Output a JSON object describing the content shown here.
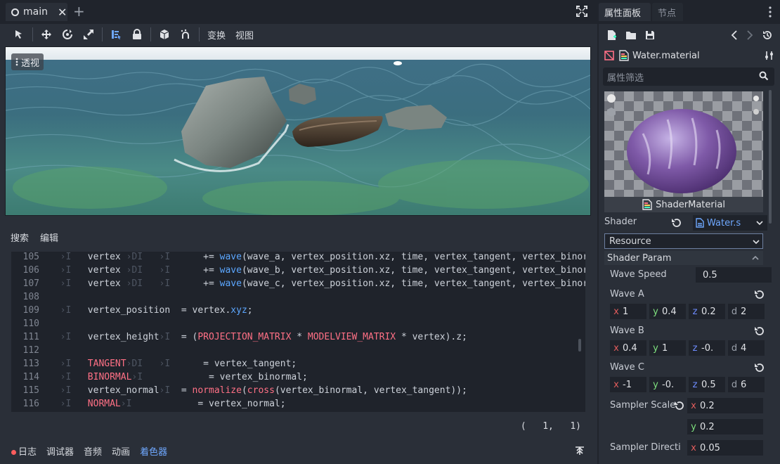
{
  "scene_tabs": {
    "active": "main"
  },
  "toolbar": {
    "transform": "变换",
    "view": "视图"
  },
  "viewport": {
    "label": "透视"
  },
  "script_editor": {
    "menu": [
      "搜索",
      "编辑"
    ],
    "lines": [
      {
        "num": "105",
        "t": [
          [
            "tab",
            "  ›I   "
          ],
          [
            "n",
            "vertex "
          ],
          [
            "tab",
            "›DI   ›I      "
          ],
          [
            "n",
            "+= "
          ],
          [
            "fn",
            "wave"
          ],
          [
            "n",
            "(wave_a, vertex_position.xz, time, vertex_tangent, vertex_binormal"
          ]
        ]
      },
      {
        "num": "106",
        "t": [
          [
            "tab",
            "  ›I   "
          ],
          [
            "n",
            "vertex "
          ],
          [
            "tab",
            "›DI   ›I      "
          ],
          [
            "n",
            "+= "
          ],
          [
            "fn",
            "wave"
          ],
          [
            "n",
            "(wave_b, vertex_position.xz, time, vertex_tangent, vertex_binormal"
          ]
        ]
      },
      {
        "num": "107",
        "t": [
          [
            "tab",
            "  ›I   "
          ],
          [
            "n",
            "vertex "
          ],
          [
            "tab",
            "›DI   ›I      "
          ],
          [
            "n",
            "+= "
          ],
          [
            "fn",
            "wave"
          ],
          [
            "n",
            "(wave_c, vertex_position.xz, time, vertex_tangent, vertex_binormal"
          ]
        ]
      },
      {
        "num": "108",
        "t": []
      },
      {
        "num": "109",
        "t": [
          [
            "tab",
            "  ›I   "
          ],
          [
            "n",
            "vertex_position  = vertex."
          ],
          [
            "fn",
            "xyz"
          ],
          [
            "n",
            ";"
          ]
        ]
      },
      {
        "num": "110",
        "t": []
      },
      {
        "num": "111",
        "t": [
          [
            "tab",
            "  ›I   "
          ],
          [
            "n",
            "vertex_height"
          ],
          [
            "tab",
            "›I  "
          ],
          [
            "n",
            "= ("
          ],
          [
            "red",
            "PROJECTION_MATRIX"
          ],
          [
            "n",
            " * "
          ],
          [
            "red",
            "MODELVIEW_MATRIX"
          ],
          [
            "n",
            " * vertex).z;"
          ]
        ]
      },
      {
        "num": "112",
        "t": []
      },
      {
        "num": "113",
        "t": [
          [
            "tab",
            "  ›I   "
          ],
          [
            "red",
            "TANGENT"
          ],
          [
            "tab",
            "›DI   ›I      "
          ],
          [
            "n",
            "= vertex_tangent;"
          ]
        ]
      },
      {
        "num": "114",
        "t": [
          [
            "tab",
            "  ›I   "
          ],
          [
            "red",
            "BINORMAL"
          ],
          [
            "tab",
            "›I            "
          ],
          [
            "n",
            "= vertex_binormal;"
          ]
        ]
      },
      {
        "num": "115",
        "t": [
          [
            "tab",
            "  ›I   "
          ],
          [
            "n",
            "vertex_normal"
          ],
          [
            "tab",
            "›I  "
          ],
          [
            "n",
            "= "
          ],
          [
            "red",
            "normalize"
          ],
          [
            "n",
            "("
          ],
          [
            "red",
            "cross"
          ],
          [
            "n",
            "(vertex_binormal, vertex_tangent));"
          ]
        ]
      },
      {
        "num": "116",
        "t": [
          [
            "tab",
            "  ›I   "
          ],
          [
            "red",
            "NORMAL"
          ],
          [
            "tab",
            "›I            "
          ],
          [
            "n",
            "= vertex_normal;"
          ]
        ]
      }
    ],
    "cursor": "(   1,   1)"
  },
  "bottom_panel": {
    "items": [
      "日志",
      "调试器",
      "音频",
      "动画",
      "着色器"
    ],
    "active": "着色器"
  },
  "inspector": {
    "tabs": [
      "属性面板",
      "节点"
    ],
    "resource_name": "Water.material",
    "filter_placeholder": "属性筛选",
    "preview_label": "ShaderMaterial",
    "shader_label": "Shader",
    "shader_value": "Water.s",
    "resource_select": "Resource",
    "section": "Shader Param",
    "wave_speed": {
      "label": "Wave Speed",
      "value": "0.5"
    },
    "wave_a": {
      "label": "Wave A",
      "x": "1",
      "y": "0.4",
      "z": "0.2",
      "d": "2"
    },
    "wave_b": {
      "label": "Wave B",
      "x": "0.4",
      "y": "1",
      "z": "-0.",
      "d": "4"
    },
    "wave_c": {
      "label": "Wave C",
      "x": "-1",
      "y": "-0.",
      "z": "0.5",
      "d": "6"
    },
    "sampler_scale": {
      "label": "Sampler Scale",
      "x": "0.2",
      "y": "0.2"
    },
    "sampler_dir": {
      "label": "Sampler Directi",
      "x": "0.05"
    },
    "axis": {
      "x": "x",
      "y": "y",
      "z": "z",
      "d": "d"
    }
  },
  "colors": {
    "accent": "#6fa8ff",
    "keyword": "#ff7085",
    "function": "#5ca7ff",
    "panel": "#2a2f38",
    "background": "#20242c"
  }
}
